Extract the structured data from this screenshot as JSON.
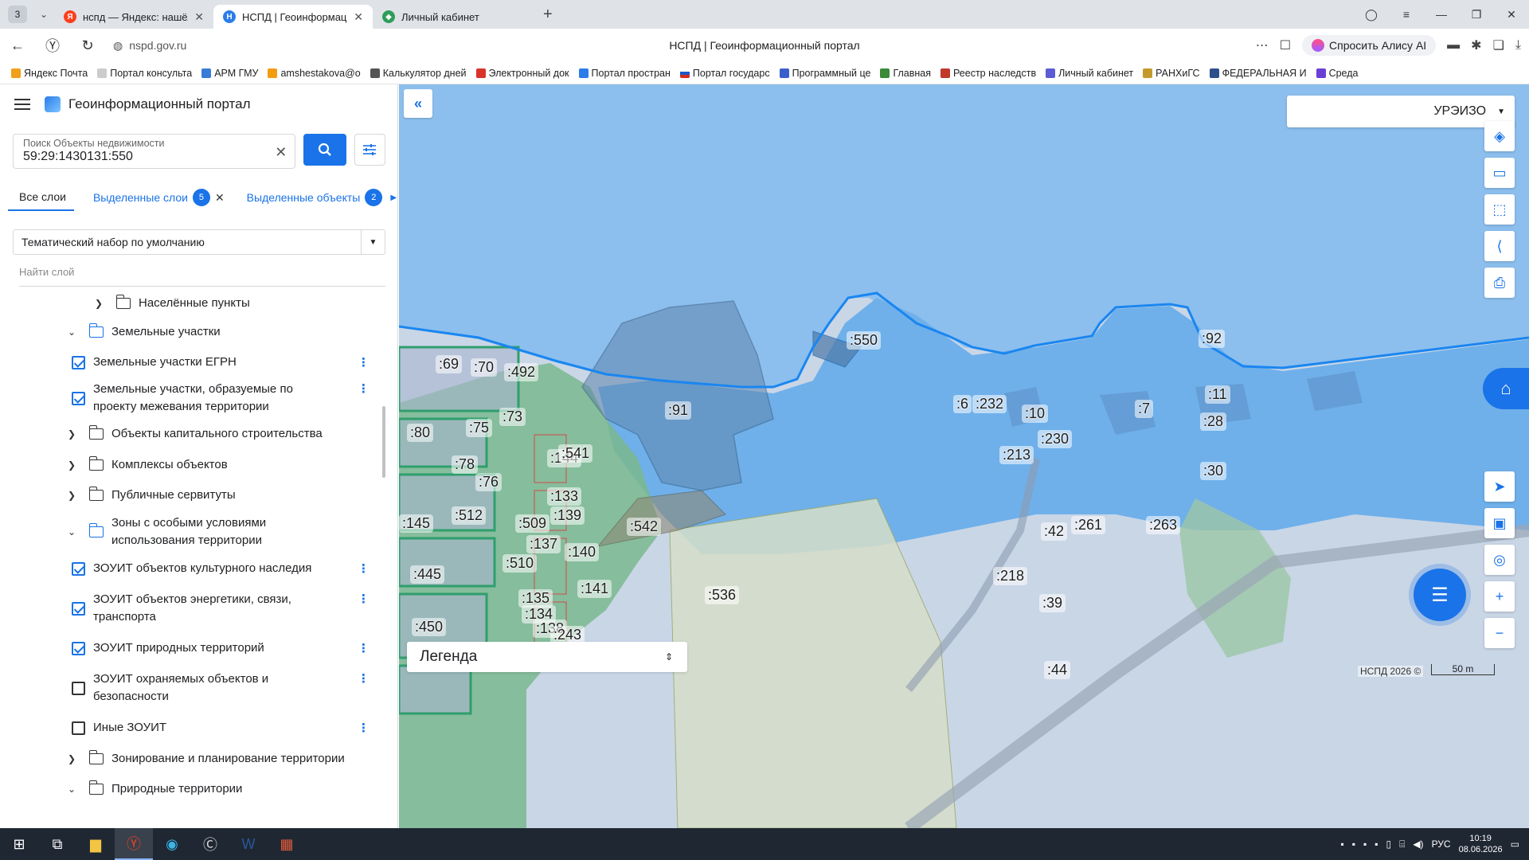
{
  "browser": {
    "tab_count": "3",
    "tabs": [
      {
        "label": "нспд — Яндекс: нашёлся",
        "icon": "yandex-icon",
        "color": "#fc3f1d"
      },
      {
        "label": "НСПД | Геоинформаци",
        "icon": "nspd-icon",
        "color": "#2b7de9"
      },
      {
        "label": "Личный кабинет",
        "icon": "shield-icon",
        "color": "#2e9d5b"
      }
    ],
    "url": "nspd.gov.ru",
    "page_title": "НСПД | Геоинформационный портал",
    "alice_label": "Спросить Алису AI",
    "bookmarks": [
      "Яндекс Почта",
      "Портал консульта",
      "АРМ ГМУ",
      "amshestakova@o",
      "Калькулятор дней",
      "Электронный док",
      "Портал простран",
      "Портал государс",
      "Программный це",
      "Главная",
      "Реестр наследств",
      "Личный кабинет",
      "РАНХиГС",
      "ФЕДЕРАЛЬНАЯ И",
      "Среда"
    ]
  },
  "app": {
    "title": "Геоинформационный портал",
    "search": {
      "placeholder": "Поиск Объекты недвижимости",
      "value": "59:29:1430131:550"
    },
    "tabs": {
      "all_layers": "Все слои",
      "selected_layers": "Выделенные слои",
      "selected_layers_count": "5",
      "selected_objects": "Выделенные объекты",
      "selected_objects_count": "2"
    },
    "theme_set": "Тематический набор по умолчанию",
    "find_layer_placeholder": "Найти слой",
    "tree": [
      {
        "type": "group",
        "label": "Населённые пункты",
        "expanded": false,
        "level": 1
      },
      {
        "type": "group",
        "label": "Земельные участки",
        "expanded": true,
        "level": 0
      },
      {
        "type": "layer",
        "label": "Земельные участки ЕГРН",
        "checked": true
      },
      {
        "type": "layer",
        "label": "Земельные участки, образуемые по проекту межевания территории",
        "checked": true
      },
      {
        "type": "group",
        "label": "Объекты капитального строительства",
        "expanded": false,
        "level": 0
      },
      {
        "type": "group",
        "label": "Комплексы объектов",
        "expanded": false,
        "level": 0
      },
      {
        "type": "group",
        "label": "Публичные сервитуты",
        "expanded": false,
        "level": 0
      },
      {
        "type": "group",
        "label": "Зоны с особыми условиями использования территории",
        "expanded": true,
        "level": 0
      },
      {
        "type": "layer",
        "label": "ЗОУИТ объектов культурного наследия",
        "checked": true
      },
      {
        "type": "layer",
        "label": "ЗОУИТ объектов энергетики, связи, транспорта",
        "checked": true
      },
      {
        "type": "layer",
        "label": "ЗОУИТ природных территорий",
        "checked": true
      },
      {
        "type": "layer",
        "label": "ЗОУИТ охраняемых объектов и безопасности",
        "checked": false
      },
      {
        "type": "layer",
        "label": "Иные ЗОУИТ",
        "checked": false
      },
      {
        "type": "group",
        "label": "Зонирование и планирование территории",
        "expanded": false,
        "level": 0
      },
      {
        "type": "group",
        "label": "Природные территории",
        "expanded": true,
        "level": 0
      }
    ]
  },
  "map": {
    "basemap_selector": "УРЭИЗО",
    "legend_label": "Легенда",
    "copyright": "НСПД 2026 ©",
    "scale": "50 m",
    "parcel_labels": [
      ":69",
      ":70",
      ":492",
      ":73",
      ":75",
      ":80",
      ":78",
      ":76",
      ":144",
      ":133",
      ":139",
      ":145",
      ":512",
      ":509",
      ":137",
      ":140",
      ":445",
      ":510",
      ":141",
      ":135",
      ":134",
      ":138",
      ":450",
      ":550",
      ":91",
      ":541",
      ":542",
      ":536",
      ":243",
      ":6",
      ":232",
      ":10",
      ":230",
      ":213",
      ":7",
      ":11",
      ":28",
      ":92",
      ":30",
      ":42",
      ":261",
      ":263",
      ":218",
      ":39",
      ":44"
    ],
    "colors": {
      "water": "#7fb6e8",
      "water_dark": "#6aa8e3",
      "river_outline": "#1a86f0",
      "land": "#c9d6e6",
      "green": "#7ab98e",
      "parcel_dark": "#6d8fb0"
    }
  },
  "taskbar": {
    "lang": "РУС",
    "time": "10:19",
    "date": "08.06.2026"
  }
}
